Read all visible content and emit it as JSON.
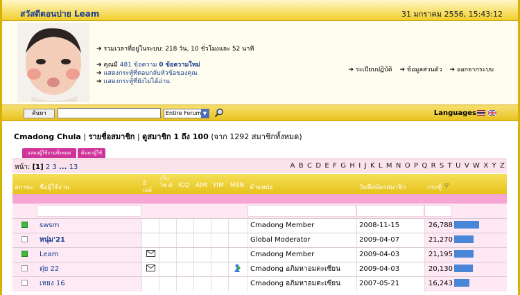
{
  "header": {
    "greeting": "สวัสดีตอนบ่าย Leam",
    "datetime": "31 มกราคม 2556, 15:43:12"
  },
  "user_panel": {
    "online_time": "รวมเวลาที่อยู่ในระบบ: 218 วัน, 10 ชั่วโมงและ 52 นาที",
    "posts_prefix": "คุณมี",
    "posts_count": "481",
    "posts_unit": "ข้อความ",
    "new_posts": "0 ข้อความใหม่",
    "replies_link": "แสดงกระทู้ที่ตอบกลับหัวข้อของคุณ",
    "unread_link": "แสดงกระทู้ที่ยังไม่ได้อ่าน",
    "right_links": [
      "ระเบียบปฏิบัติ",
      "ข้อมูลส่วนตัว",
      "ออกจากระบบ"
    ]
  },
  "search": {
    "button": "ค้นหา",
    "select_value": "Entire Forum",
    "languages_label": "Languages"
  },
  "breadcrumb": {
    "site": "Cmadong Chula",
    "sep1": "|",
    "section": "รายชื่อสมาชิก",
    "sep2": "|",
    "range": "ดูสมาชิก 1 ถึง 100",
    "total": "(จาก 1292 สมาชิกทั้งหมด)"
  },
  "tabs": [
    "แสดงผู้ใช้งานทั้งหมด",
    "ค้นหาผู้ใช้"
  ],
  "pager": {
    "label": "หน้า:",
    "current": "[1]",
    "pages": [
      "2",
      "3"
    ],
    "ellipsis": "...",
    "last": "13"
  },
  "alphabet": "A B C D E F G H I J K L M N O P Q R S T U V W X Y Z",
  "table": {
    "headers": {
      "status": "สถานะ",
      "username": "ชื่อผู้ใช้งาน",
      "email": "อี เมล์",
      "website": "เว็บ ไซ ต์",
      "icq": "ICQ",
      "aim": "AIM",
      "yim": "YIM",
      "msn": "MSN",
      "rank": "ตำแหน่ง",
      "joined": "วันที่สมัครสมาชิก",
      "posts": "กระทู้"
    },
    "rows": [
      {
        "online": true,
        "name": "swsm",
        "email": false,
        "msn": false,
        "rank": "Cmadong Member",
        "joined": "2008-11-15",
        "posts": "26,788",
        "posts_fraction": 1.0
      },
      {
        "online": false,
        "name": "หนุ่ม'21",
        "email": false,
        "msn": false,
        "rank": "Global Moderator",
        "joined": "2009-04-07",
        "posts": "21,270",
        "posts_fraction": 0.79
      },
      {
        "online": true,
        "name": "Leam",
        "email": true,
        "msn": false,
        "rank": "Cmadong Member",
        "joined": "2009-04-03",
        "posts": "21,195",
        "posts_fraction": 0.79
      },
      {
        "online": false,
        "name": "ตุ่ย 22",
        "email": true,
        "msn": true,
        "rank": "Cmadong อภิมหาอมตะเซียน",
        "joined": "2009-04-03",
        "posts": "20,130",
        "posts_fraction": 0.75
      },
      {
        "online": false,
        "name": "เหยง 16",
        "email": false,
        "msn": false,
        "rank": "Cmadong อภิมหาอมตะเซียน",
        "joined": "2007-05-21",
        "posts": "16,243",
        "posts_fraction": 0.61
      }
    ]
  }
}
